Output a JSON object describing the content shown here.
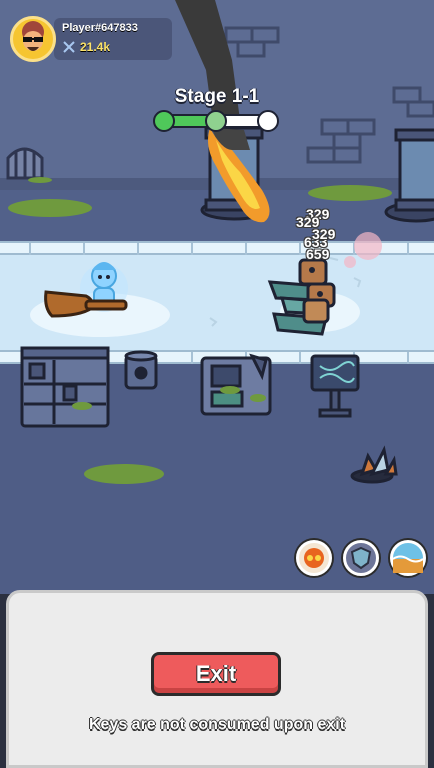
{
  "player": {
    "name": "Player#647833",
    "power": "21.4k"
  },
  "stage": {
    "title": "Stage 1-1",
    "progress": 0.5,
    "nodes": [
      "cleared",
      "current",
      "locked"
    ]
  },
  "combat": {
    "damage_numbers": [
      "329",
      "329",
      "633",
      "329",
      "659"
    ]
  },
  "skills": [
    {
      "icon": "fire-orb-icon"
    },
    {
      "icon": "shield-icon"
    },
    {
      "icon": "water-wave-icon"
    }
  ],
  "panel": {
    "exit_label": "Exit",
    "note": "Keys are not consumed upon exit"
  },
  "colors": {
    "exit_button": "#ee5b5c",
    "progress_fill": "#4fc85a",
    "power_text": "#fbe26a"
  }
}
